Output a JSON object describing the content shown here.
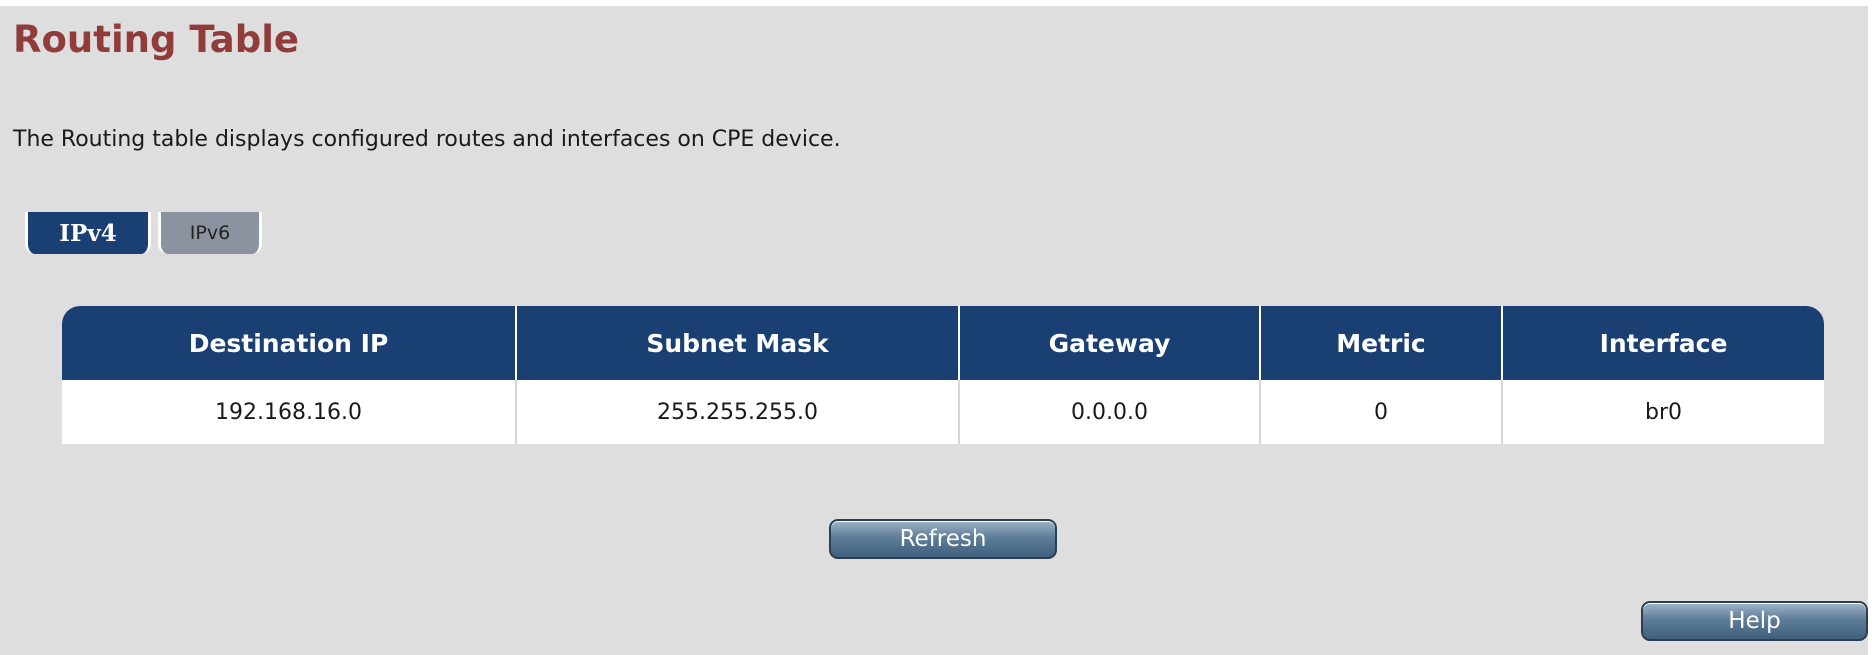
{
  "page": {
    "title": "Routing Table",
    "description": "The Routing table displays configured routes and interfaces on CPE device."
  },
  "tabs": [
    {
      "label": "IPv4",
      "active": true
    },
    {
      "label": "IPv6",
      "active": false
    }
  ],
  "table": {
    "headers": [
      "Destination IP",
      "Subnet Mask",
      "Gateway",
      "Metric",
      "Interface"
    ],
    "rows": [
      [
        "192.168.16.0",
        "255.255.255.0",
        "0.0.0.0",
        "0",
        "br0"
      ]
    ]
  },
  "buttons": {
    "refresh": "Refresh",
    "help": "Help"
  },
  "colors": {
    "title": "#8f3c3a",
    "header_bg": "#1a3f73",
    "page_bg": "#dedede",
    "inactive_tab": "#8b93a0"
  }
}
